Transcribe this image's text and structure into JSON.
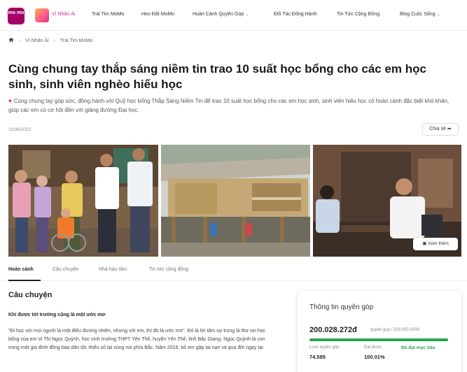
{
  "nav": {
    "logo_text": "mo mo",
    "items": [
      {
        "label": "Ví Nhân Ái",
        "active": true
      },
      {
        "label": "Trái Tim MoMo"
      },
      {
        "label": "Heo Đất MoMo"
      },
      {
        "label": "Hoàn Cảnh Quyên Góp",
        "dropdown": true
      },
      {
        "label": "Đối Tác Đồng Hành"
      },
      {
        "label": "Tin Tức Cộng Đồng"
      },
      {
        "label": "Blog Cuộc Sống",
        "dropdown": true
      }
    ]
  },
  "breadcrumb": [
    "Ví Nhân Ái",
    "Trái Tim MoMo"
  ],
  "article": {
    "title": "Cùng chung tay thắp sáng niềm tin trao 10 suất học bổng cho các em học sinh, sinh viên nghèo hiếu học",
    "description": "Cùng chung tay góp sức, đồng hành với Quỹ học bổng Thắp Sáng Niềm Tin để trao 10 suất học bổng cho các em học sinh, sinh viên hiếu học có hoàn cảnh đặc biệt khó khăn, giúp các em có cơ hội đến với giảng đường Đại học.",
    "date": "11/08/2022",
    "share_label": "Chia sẻ"
  },
  "gallery": {
    "view_button": "Xem thêm"
  },
  "tabs": [
    "Hoàn cảnh",
    "Câu chuyện",
    "Nhà hảo tâm",
    "Tin tức cộng đồng"
  ],
  "story": {
    "heading": "Câu chuyện",
    "subheading": "Khi được tới trường cũng là một ước mơ",
    "paragraph": "\"Đi học với mọi người là một điều đương nhiên, nhưng với em, thì đó là ước mơ\". Đó là lời tâm sự trong lá thư xin học bổng của em Vi Thị Ngọc Quỳnh, học sinh trường THPT Yên Thế, huyện Yên Thế, tỉnh Bắc Giang. Ngọc Quỳnh là con trong một gia đình đồng bào dân tộc thiểu số tại vùng núi phía Bắc. Năm 2018, bố em gặp tai nạn và qua đời ngay tại"
  },
  "donation": {
    "title": "Thông tin quyên góp",
    "amount": "200.028.272đ",
    "goal": "quyên góp / 200.000.000đ",
    "progress_percent": 100,
    "donations_label": "Lượt quyên góp",
    "donations_value": "74.585",
    "reached_label": "Đạt được",
    "reached_value": "100.01%",
    "status": "Đã đạt mục tiêu",
    "accent_color": "#2ca44f"
  },
  "colors": {
    "brand": "#a50064",
    "active_nav": "#d82d8b"
  }
}
